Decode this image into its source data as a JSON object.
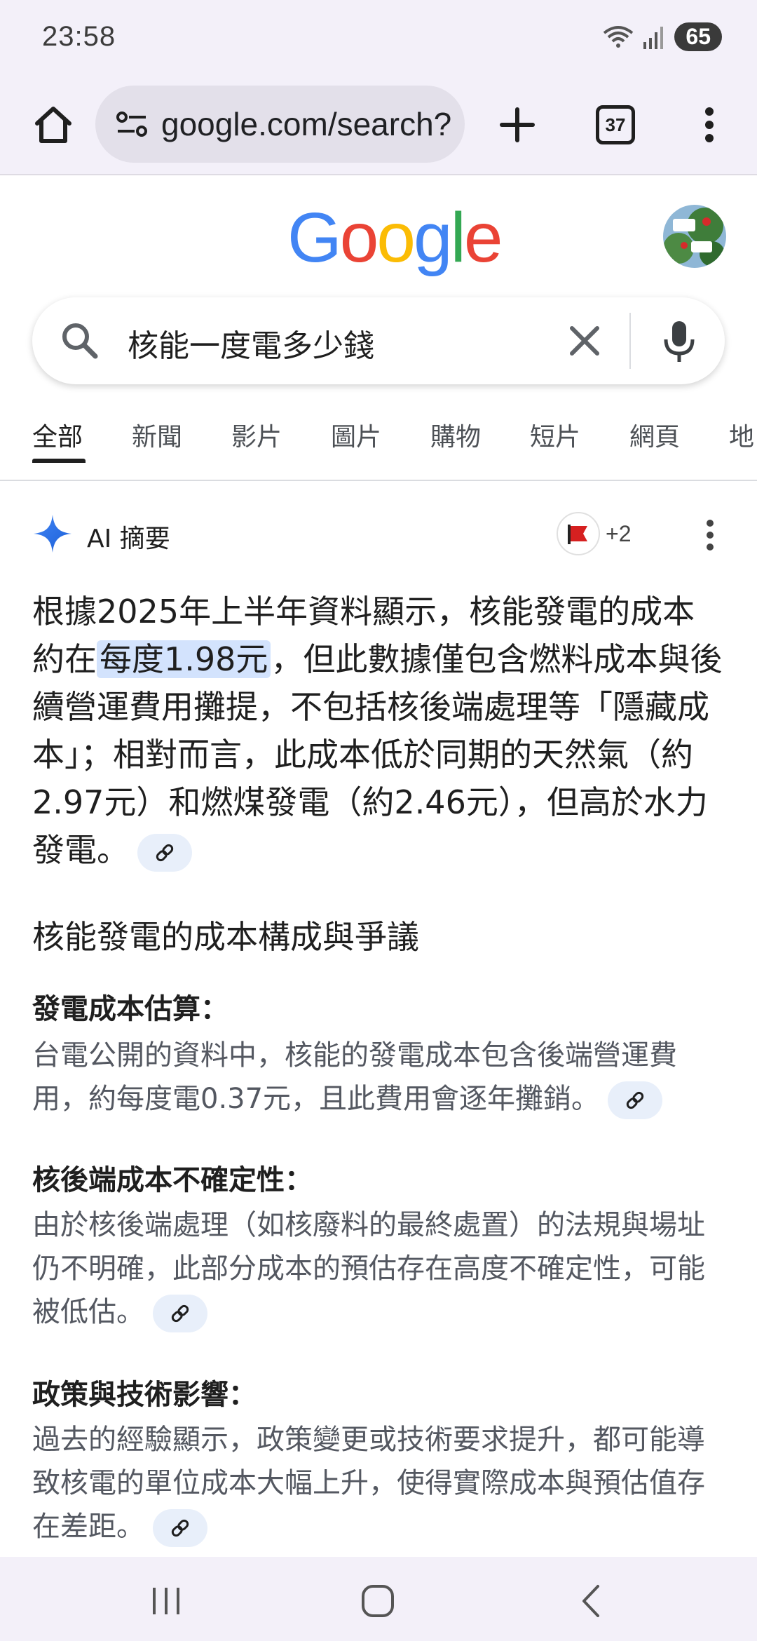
{
  "status": {
    "time": "23:58",
    "battery": "65"
  },
  "browser": {
    "url": "google.com/search?",
    "tab_count": "37"
  },
  "search": {
    "query": "核能一度電多少錢"
  },
  "google_logo": [
    "G",
    "o",
    "o",
    "g",
    "l",
    "e"
  ],
  "tabs": [
    "全部",
    "新聞",
    "影片",
    "圖片",
    "購物",
    "短片",
    "網頁",
    "地"
  ],
  "ai": {
    "title": "AI 摘要",
    "sources_more": "+2",
    "summary_part1": "根據2025年上半年資料顯示，核能發電的成本約在",
    "summary_highlight": "每度1.98元",
    "summary_part2": "，但此數據僅包含燃料成本與後續營運費用攤提，不包括核後端處理等「隱藏成本」；相對而言，此成本低於同期的天然氣（約2.97元）和燃煤發電（約2.46元），但高於水力發電。"
  },
  "section": {
    "heading": "核能發電的成本構成與爭議",
    "items": [
      {
        "title": "發電成本估算：",
        "body": "台電公開的資料中，核能的發電成本包含後端營運費用，約每度電0.37元，且此費用會逐年攤銷。"
      },
      {
        "title": "核後端成本不確定性：",
        "body": "由於核後端處理（如核廢料的最終處置）的法規與場址仍不明確，此部分成本的預估存在高度不確定性，可能被低估。"
      },
      {
        "title": "政策與技術影響：",
        "body": "過去的經驗顯示，政策變更或技術要求提升，都可能導致核電的單位成本大幅上升，使得實際成本與預估值存在差距。"
      }
    ]
  },
  "colors": {
    "accent_blue": "#4285F4",
    "highlight": "#d3e3fd",
    "chrome_bg": "#f3f0f9"
  },
  "icons": {
    "home": "home-icon",
    "tune": "site-settings-icon",
    "new_tab": "plus-icon",
    "tabs": "tab-switcher-icon",
    "menu": "more-vert-icon",
    "search": "search-icon",
    "clear": "close-icon",
    "mic": "mic-icon",
    "ai": "gemini-sparkle-icon",
    "link": "link-icon",
    "nav_recents": "recents-icon",
    "nav_home": "nav-home-icon",
    "nav_back": "back-icon"
  }
}
